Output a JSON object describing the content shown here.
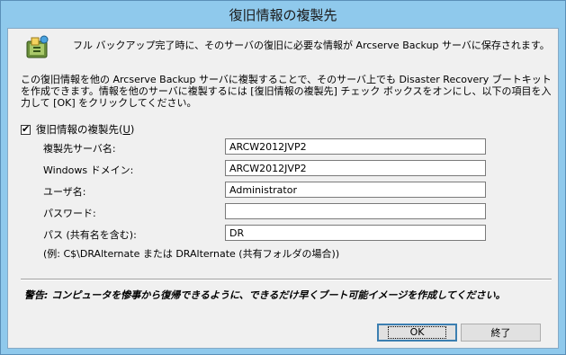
{
  "window": {
    "title": "復旧情報の複製先"
  },
  "intro_text": "フル バックアップ完了時に、そのサーバの復旧に必要な情報が Arcserve Backup サーバに保存されます。",
  "description": "この復旧情報を他の Arcserve Backup サーバに複製することで、そのサーバ上でも Disaster Recovery ブートキットを作成できます。情報を他のサーバに複製するには [復旧情報の複製先] チェック ボックスをオンにし、以下の項目を入力して [OK] をクリックしてください。",
  "checkbox": {
    "label": "復旧情報の複製先(",
    "accel": "U",
    "label_suffix": ")",
    "checked": true
  },
  "fields": [
    {
      "label": "複製先サーバ名:",
      "value": ""
    },
    {
      "label": "Windows ドメイン:",
      "value": "ARCW2012JVP2"
    },
    {
      "label": "ユーザ名:",
      "value": "Administrator"
    },
    {
      "label": "パスワード:",
      "value": ""
    },
    {
      "label": "パス (共有名を含む):",
      "value": "DR"
    }
  ],
  "server_value": "ARCW2012JVP2",
  "example_text": "(例: C$\\DRAlternate または DRAlternate (共有フォルダの場合))",
  "warning_text": "警告: コンピュータを惨事から復帰できるように、できるだけ早くブート可能イメージを作成してください。",
  "buttons": {
    "ok_label": "OK",
    "close_label": "終了"
  },
  "colors": {
    "frame": "#8fc9ec",
    "client_bg": "#f0f0f0",
    "button_bg": "#e1e1e1",
    "default_button_border": "#3c7fb1"
  },
  "icons": {
    "info": "backup-info-icon",
    "check": "check-mark-icon"
  }
}
